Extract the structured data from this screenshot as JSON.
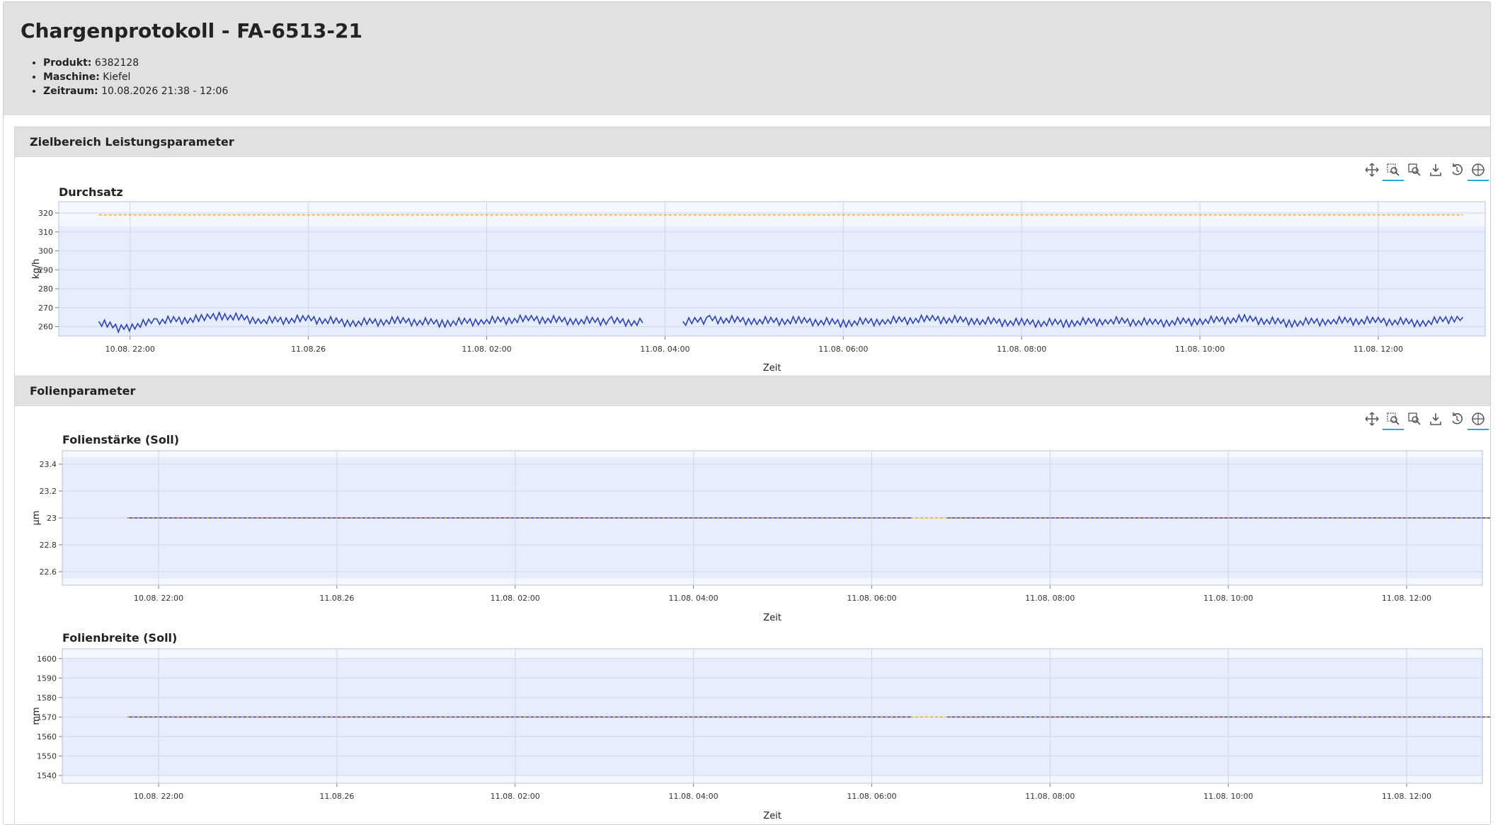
{
  "header": {
    "title": "Chargenprotokoll - FA-6513-21",
    "meta": [
      {
        "label": "Produkt:",
        "value": "6382128"
      },
      {
        "label": "Maschine:",
        "value": "Kiefel"
      },
      {
        "label": "Zeitraum:",
        "value": "10.08.2026 21:38 - 12:06"
      }
    ]
  },
  "toolbar_icons": [
    "pan-icon",
    "box-zoom-icon",
    "wheel-zoom-icon",
    "save-icon",
    "reset-icon",
    "hover-icon"
  ],
  "colors": {
    "series_line": "#2c3fbf",
    "target_line": "#f5a623",
    "band_fill": "#e8eefc",
    "panel_header": "#e1e1e1"
  },
  "panels": [
    {
      "title": "Zielbereich Leistungsparameter"
    },
    {
      "title": "Folienparameter"
    }
  ],
  "chart_data": [
    {
      "type": "line",
      "title": "Durchsatz",
      "xlabel": "Zeit",
      "ylabel": "kg/h",
      "x_ticks": [
        "10.08. 22:00",
        "11.08.26",
        "11.08. 02:00",
        "11.08. 04:00",
        "11.08. 06:00",
        "11.08. 08:00",
        "11.08. 10:00",
        "11.08. 12:00"
      ],
      "x_range_hours": [
        -0.8,
        15.2
      ],
      "y_ticks": [
        260,
        270,
        280,
        290,
        300,
        310,
        320
      ],
      "ylim": [
        255,
        326
      ],
      "band": [
        255,
        313
      ],
      "target": 319,
      "series": {
        "x_hours": [
          -0.35,
          -0.1,
          0.3,
          0.8,
          1.0,
          1.5,
          2.0,
          2.5,
          3.0,
          3.5,
          4.0,
          4.5,
          5.0,
          5.4,
          5.75,
          5.85,
          6.2,
          6.5,
          7.0,
          7.5,
          8.0,
          8.5,
          9.0,
          9.5,
          10.0,
          10.5,
          11.0,
          11.5,
          12.0,
          12.5,
          13.0,
          13.5,
          14.0,
          14.5,
          14.95
        ],
        "y": [
          262,
          259,
          263,
          264,
          266,
          263,
          264,
          262,
          263,
          262,
          263,
          264,
          263,
          263,
          262,
          null,
          262,
          264,
          263,
          263,
          262,
          263,
          264,
          263,
          262,
          262,
          263,
          262,
          263,
          264,
          262,
          263,
          263,
          262,
          265
        ]
      },
      "grid": true
    },
    {
      "type": "line",
      "title": "Folienstärke (Soll)",
      "xlabel": "Zeit",
      "ylabel": "μm",
      "x_ticks": [
        "10.08. 22:00",
        "11.08.26",
        "11.08. 02:00",
        "11.08. 04:00",
        "11.08. 06:00",
        "11.08. 08:00",
        "11.08. 10:00",
        "11.08. 12:00"
      ],
      "x_range_hours": [
        -1.08,
        14.85
      ],
      "y_ticks": [
        22.6,
        22.8,
        23,
        23.2,
        23.4
      ],
      "y_tick_labels": [
        "22.6",
        "22.8",
        "23",
        "23.2",
        "23.4"
      ],
      "ylim": [
        22.5,
        23.5
      ],
      "band": [
        22.55,
        23.45
      ],
      "target": 23,
      "series": {
        "x_hours": [
          -0.35,
          8.45,
          8.85,
          14.95
        ],
        "y": [
          23,
          23,
          23,
          23
        ],
        "gap_after_index": 1
      },
      "grid": true
    },
    {
      "type": "line",
      "title": "Folienbreite (Soll)",
      "xlabel": "Zeit",
      "ylabel": "mm",
      "x_ticks": [
        "10.08. 22:00",
        "11.08.26",
        "11.08. 02:00",
        "11.08. 04:00",
        "11.08. 06:00",
        "11.08. 08:00",
        "11.08. 10:00",
        "11.08. 12:00"
      ],
      "x_range_hours": [
        -1.08,
        14.85
      ],
      "y_ticks": [
        1540,
        1550,
        1560,
        1570,
        1580,
        1590,
        1600
      ],
      "ylim": [
        1536,
        1605
      ],
      "band": [
        1540,
        1600
      ],
      "target": 1570,
      "series": {
        "x_hours": [
          -0.35,
          8.45,
          8.85,
          14.95
        ],
        "y": [
          1570,
          1570,
          1570,
          1570
        ],
        "gap_after_index": 1
      },
      "grid": true
    }
  ]
}
